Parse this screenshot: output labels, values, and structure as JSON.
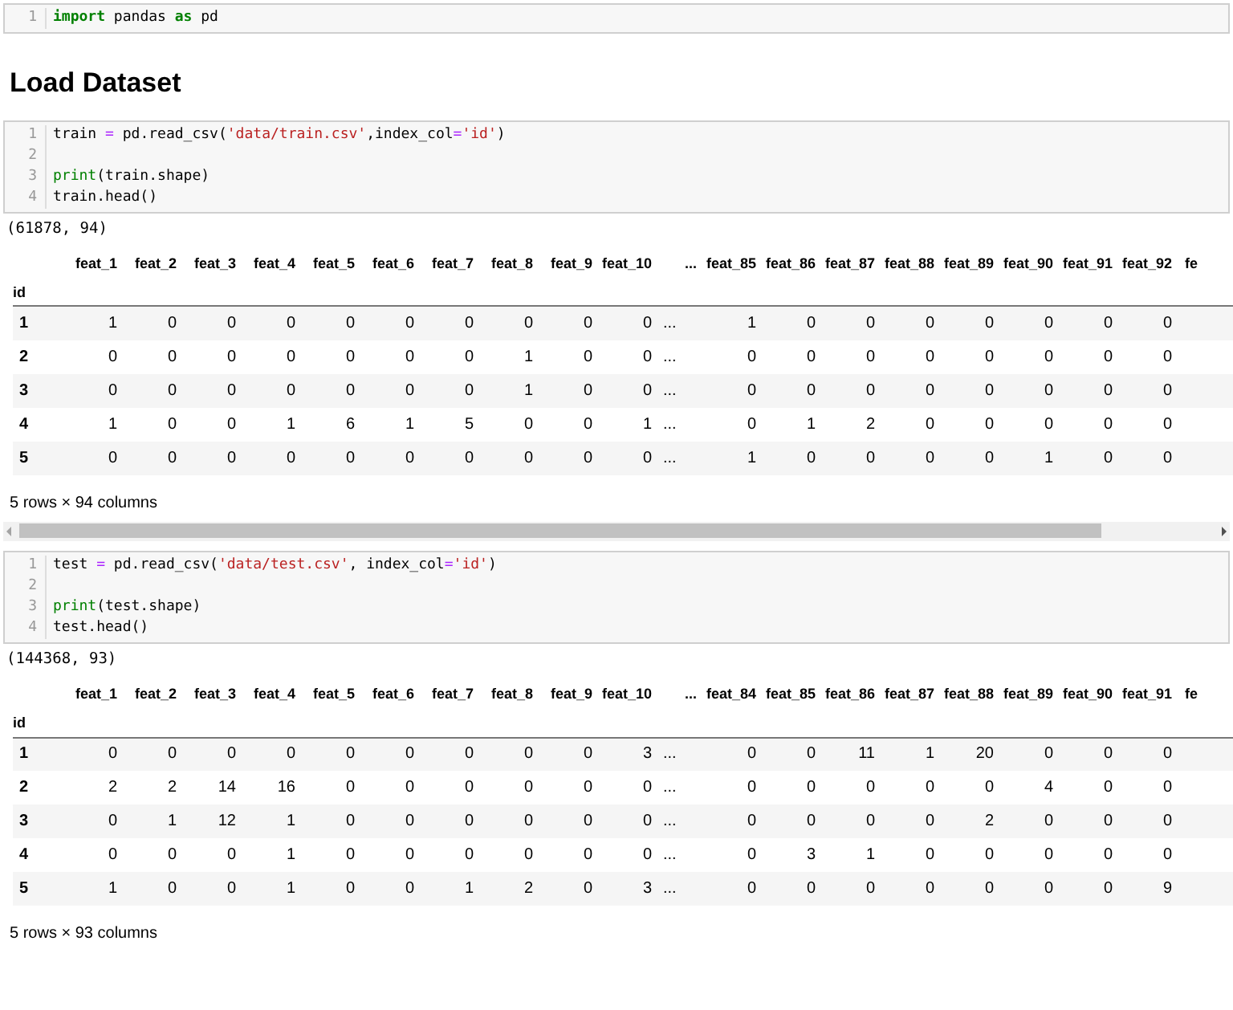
{
  "cells": [
    {
      "kind": "code",
      "lines": [
        {
          "number": "1",
          "tokens": [
            {
              "text": "import",
              "kind": "keyword"
            },
            {
              "text": " pandas ",
              "kind": "plain"
            },
            {
              "text": "as",
              "kind": "keyword"
            },
            {
              "text": " pd",
              "kind": "plain"
            }
          ]
        }
      ]
    },
    {
      "kind": "heading",
      "text": "Load Dataset"
    },
    {
      "kind": "code",
      "lines": [
        {
          "number": "1",
          "tokens": [
            {
              "text": "train ",
              "kind": "plain"
            },
            {
              "text": "=",
              "kind": "operator"
            },
            {
              "text": " pd.read_csv(",
              "kind": "plain"
            },
            {
              "text": "'data/train.csv'",
              "kind": "string"
            },
            {
              "text": ",index_col",
              "kind": "plain"
            },
            {
              "text": "=",
              "kind": "operator"
            },
            {
              "text": "'id'",
              "kind": "string"
            },
            {
              "text": ")",
              "kind": "plain"
            }
          ]
        },
        {
          "number": "2"
        },
        {
          "number": "3",
          "tokens": [
            {
              "text": "print",
              "kind": "builtin"
            },
            {
              "text": "(train.shape)",
              "kind": "plain"
            }
          ]
        },
        {
          "number": "4",
          "tokens": [
            {
              "text": "train.head()",
              "kind": "plain"
            }
          ]
        }
      ]
    },
    {
      "kind": "output",
      "text": "(61878, 94)"
    },
    {
      "kind": "table",
      "index_name": "id",
      "columns": [
        "feat_1",
        "feat_2",
        "feat_3",
        "feat_4",
        "feat_5",
        "feat_6",
        "feat_7",
        "feat_8",
        "feat_9",
        "feat_10",
        "...",
        "feat_85",
        "feat_86",
        "feat_87",
        "feat_88",
        "feat_89",
        "feat_90",
        "feat_91",
        "feat_92",
        "fe"
      ],
      "rows": [
        {
          "index": "1",
          "values": [
            "1",
            "0",
            "0",
            "0",
            "0",
            "0",
            "0",
            "0",
            "0",
            "0",
            "...",
            "1",
            "0",
            "0",
            "0",
            "0",
            "0",
            "0",
            "0"
          ]
        },
        {
          "index": "2",
          "values": [
            "0",
            "0",
            "0",
            "0",
            "0",
            "0",
            "0",
            "1",
            "0",
            "0",
            "...",
            "0",
            "0",
            "0",
            "0",
            "0",
            "0",
            "0",
            "0"
          ]
        },
        {
          "index": "3",
          "values": [
            "0",
            "0",
            "0",
            "0",
            "0",
            "0",
            "0",
            "1",
            "0",
            "0",
            "...",
            "0",
            "0",
            "0",
            "0",
            "0",
            "0",
            "0",
            "0"
          ]
        },
        {
          "index": "4",
          "values": [
            "1",
            "0",
            "0",
            "1",
            "6",
            "1",
            "5",
            "0",
            "0",
            "1",
            "...",
            "0",
            "1",
            "2",
            "0",
            "0",
            "0",
            "0",
            "0"
          ]
        },
        {
          "index": "5",
          "values": [
            "0",
            "0",
            "0",
            "0",
            "0",
            "0",
            "0",
            "0",
            "0",
            "0",
            "...",
            "1",
            "0",
            "0",
            "0",
            "0",
            "1",
            "0",
            "0"
          ]
        }
      ],
      "footer": "5 rows × 94 columns",
      "scrollbar": true
    },
    {
      "kind": "code",
      "lines": [
        {
          "number": "1",
          "tokens": [
            {
              "text": "test ",
              "kind": "plain"
            },
            {
              "text": "=",
              "kind": "operator"
            },
            {
              "text": " pd.read_csv(",
              "kind": "plain"
            },
            {
              "text": "'data/test.csv'",
              "kind": "string"
            },
            {
              "text": ", index_col",
              "kind": "plain"
            },
            {
              "text": "=",
              "kind": "operator"
            },
            {
              "text": "'id'",
              "kind": "string"
            },
            {
              "text": ")",
              "kind": "plain"
            }
          ]
        },
        {
          "number": "2"
        },
        {
          "number": "3",
          "tokens": [
            {
              "text": "print",
              "kind": "builtin"
            },
            {
              "text": "(test.shape)",
              "kind": "plain"
            }
          ]
        },
        {
          "number": "4",
          "tokens": [
            {
              "text": "test.head()",
              "kind": "plain"
            }
          ]
        }
      ]
    },
    {
      "kind": "output",
      "text": "(144368, 93)"
    },
    {
      "kind": "table",
      "index_name": "id",
      "columns": [
        "feat_1",
        "feat_2",
        "feat_3",
        "feat_4",
        "feat_5",
        "feat_6",
        "feat_7",
        "feat_8",
        "feat_9",
        "feat_10",
        "...",
        "feat_84",
        "feat_85",
        "feat_86",
        "feat_87",
        "feat_88",
        "feat_89",
        "feat_90",
        "feat_91",
        "fe"
      ],
      "rows": [
        {
          "index": "1",
          "values": [
            "0",
            "0",
            "0",
            "0",
            "0",
            "0",
            "0",
            "0",
            "0",
            "3",
            "...",
            "0",
            "0",
            "11",
            "1",
            "20",
            "0",
            "0",
            "0"
          ]
        },
        {
          "index": "2",
          "values": [
            "2",
            "2",
            "14",
            "16",
            "0",
            "0",
            "0",
            "0",
            "0",
            "0",
            "...",
            "0",
            "0",
            "0",
            "0",
            "0",
            "4",
            "0",
            "0"
          ]
        },
        {
          "index": "3",
          "values": [
            "0",
            "1",
            "12",
            "1",
            "0",
            "0",
            "0",
            "0",
            "0",
            "0",
            "...",
            "0",
            "0",
            "0",
            "0",
            "2",
            "0",
            "0",
            "0"
          ]
        },
        {
          "index": "4",
          "values": [
            "0",
            "0",
            "0",
            "1",
            "0",
            "0",
            "0",
            "0",
            "0",
            "0",
            "...",
            "0",
            "3",
            "1",
            "0",
            "0",
            "0",
            "0",
            "0"
          ]
        },
        {
          "index": "5",
          "values": [
            "1",
            "0",
            "0",
            "1",
            "0",
            "0",
            "1",
            "2",
            "0",
            "3",
            "...",
            "0",
            "0",
            "0",
            "0",
            "0",
            "0",
            "0",
            "9"
          ]
        }
      ],
      "footer": "5 rows × 93 columns",
      "scrollbar": false
    }
  ]
}
